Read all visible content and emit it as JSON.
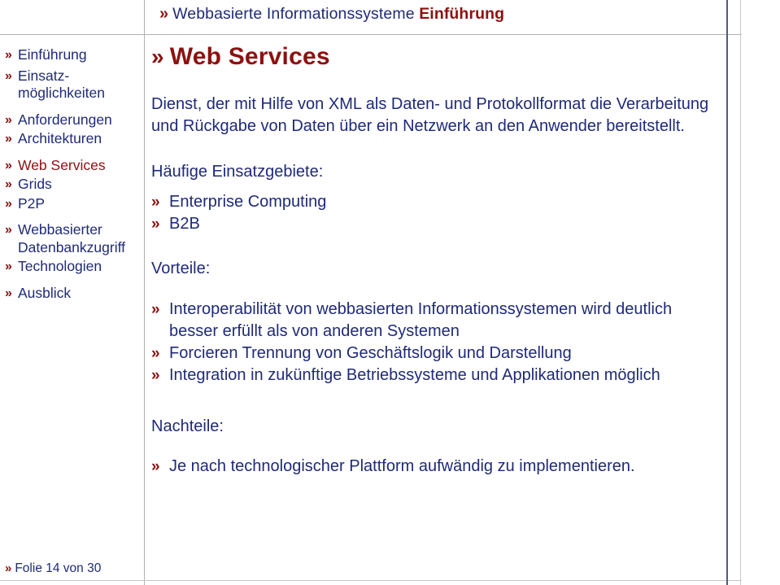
{
  "header": {
    "chevron": "»",
    "title_main": "Webbasierte Informationssysteme",
    "title_accent": "Einführung"
  },
  "colors": {
    "accent_red": "#8c1111",
    "body_blue": "#1f2a78",
    "rule_grey": "#b3b0ad",
    "rule_blue": "#54597f"
  },
  "sidebar": {
    "items": [
      {
        "label": "Einführung",
        "active": false
      },
      {
        "label": "Einsatz-",
        "label2": "möglichkeiten",
        "active": false
      },
      {
        "label": "Anforderungen",
        "active": false
      },
      {
        "label": "Architekturen",
        "active": false
      },
      {
        "label": "Web Services",
        "active": true
      },
      {
        "label": "Grids",
        "active": false
      },
      {
        "label": "P2P",
        "active": false
      },
      {
        "label": "Webbasierter",
        "label2": "Datenbankzugriff",
        "active": false
      },
      {
        "label": "Technologien",
        "active": false
      },
      {
        "label": "Ausblick",
        "active": false
      }
    ]
  },
  "main": {
    "title": "Web Services",
    "definition": "Dienst, der mit Hilfe von XML als Daten- und Protokollformat die Verarbeitung und Rückgabe von Daten über ein Netzwerk an den Anwender bereitstellt.",
    "usecases_heading": "Häufige Einsatzgebiete:",
    "usecases": [
      "Enterprise Computing",
      "B2B"
    ],
    "benefits_heading": "Vorteile:",
    "benefits": [
      "Interoperabilität von webbasierten Informationssystemen wird deutlich besser erfüllt als von anderen Systemen",
      "Forcieren Trennung von Geschäftslogik und Darstellung",
      "Integration in zukünftige Betriebssysteme und Applikationen möglich"
    ],
    "drawbacks_heading": "Nachteile:",
    "drawbacks": [
      "Je nach technologischer Plattform aufwändig zu implementieren."
    ]
  },
  "footer": {
    "chevron": "»",
    "text": "Folie 14 von 30"
  }
}
